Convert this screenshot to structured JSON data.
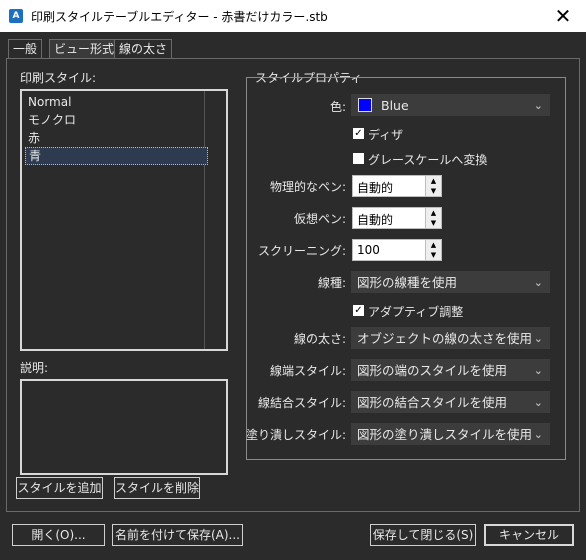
{
  "window": {
    "title": "印刷スタイルテーブルエディター - 赤書だけカラー.stb",
    "icon": "autocad-a-icon"
  },
  "tabs": [
    {
      "label": "一般"
    },
    {
      "label": "ビュー形式"
    },
    {
      "label": "線の太さ"
    }
  ],
  "left": {
    "styles_label": "印刷スタイル:",
    "styles": [
      "Normal",
      "モノクロ",
      "赤",
      "青"
    ],
    "selected_style": "青",
    "description_label": "説明:",
    "description": "",
    "add_style": "スタイルを追加",
    "delete_style": "スタイルを削除"
  },
  "props": {
    "group_title": "スタイルプロパティ",
    "color": {
      "label": "色:",
      "value": "Blue",
      "swatch": "#0000ff"
    },
    "dither": {
      "label": "ディザ",
      "checked": true
    },
    "grayscale": {
      "label": "グレースケールへ変換",
      "checked": false
    },
    "physical_pen": {
      "label": "物理的なペン:",
      "value": "自動的"
    },
    "virtual_pen": {
      "label": "仮想ペン:",
      "value": "自動的"
    },
    "screening": {
      "label": "スクリーニング:",
      "value": "100"
    },
    "linetype": {
      "label": "線種:",
      "value": "図形の線種を使用"
    },
    "adaptive": {
      "label": "アダプティブ調整",
      "checked": true
    },
    "lineweight": {
      "label": "線の太さ:",
      "value": "オブジェクトの線の太さを使用"
    },
    "line_end": {
      "label": "線端スタイル:",
      "value": "図形の端のスタイルを使用"
    },
    "line_join": {
      "label": "線結合スタイル:",
      "value": "図形の結合スタイルを使用"
    },
    "fill": {
      "label": "塗り潰しスタイル:",
      "value": "図形の塗り潰しスタイルを使用"
    }
  },
  "footer": {
    "open": "開く(O)...",
    "save_as": "名前を付けて保存(A)...",
    "save_close": "保存して閉じる(S)",
    "cancel": "キャンセル"
  },
  "colors": {
    "dialog_bg": "#2b2b2b",
    "titlebar_bg": "#ffffff",
    "swatch_blue": "#0000ff"
  }
}
